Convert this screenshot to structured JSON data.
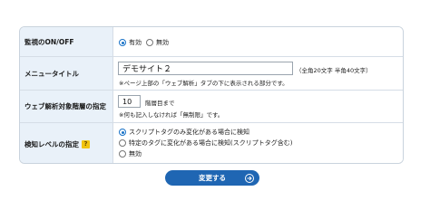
{
  "monitoring": {
    "label": "監視のON/OFF",
    "options": [
      {
        "label": "有効",
        "checked": true
      },
      {
        "label": "無効",
        "checked": false
      }
    ]
  },
  "menu_title": {
    "label": "メニュータイトル",
    "value": "デモサイト２",
    "limit_note": "（全角20文字 半角40文字）",
    "note": "※ページ上部の「ウェブ解析」タブの下に表示される部分です。"
  },
  "depth": {
    "label": "ウェブ解析対象階層の指定",
    "value": "10",
    "suffix": "階層目まで",
    "note": "※何も記入しなければ「無制限」です。"
  },
  "detect_level": {
    "label": "検知レベルの指定",
    "help_badge": "?",
    "options": [
      {
        "label": "スクリプトタグのみ変化がある場合に検知",
        "checked": true
      },
      {
        "label": "特定のタグに変化がある場合に検知(スクリプトタグ含む)",
        "checked": false
      },
      {
        "label": "無効",
        "checked": false
      }
    ]
  },
  "submit": {
    "label": "変更する"
  },
  "colors": {
    "accent": "#1f66b3",
    "label_bg": "#e9f1f9",
    "help_badge": "#f1c40f"
  }
}
